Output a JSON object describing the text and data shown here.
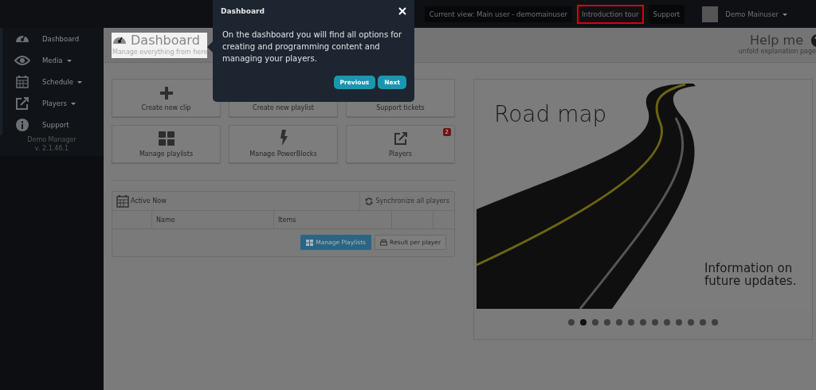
{
  "topbar": {
    "current_view": "Current view: Main user - demomainuser",
    "links": [
      {
        "label": "Introduction tour",
        "highlighted": true
      },
      {
        "label": "Support",
        "highlighted": false
      }
    ],
    "user": "Demo Mainuser"
  },
  "sidebar": {
    "items": [
      {
        "label": "Dashboard",
        "kind": "gauge",
        "has_menu": false
      },
      {
        "label": "Media",
        "kind": "eye",
        "has_menu": true
      },
      {
        "label": "Schedule",
        "kind": "calendar",
        "has_menu": true
      },
      {
        "label": "Players",
        "kind": "external",
        "has_menu": true
      },
      {
        "label": "Support",
        "kind": "info",
        "has_menu": false
      }
    ],
    "app_name": "Demo Manager",
    "version": "v. 2.1.46.1"
  },
  "header": {
    "title": "Dashboard",
    "subtitle": "Manage everything from here",
    "help_title": "Help me",
    "help_subtitle": "unfold explanation page"
  },
  "tiles": [
    {
      "label": "Create new clip",
      "kind": "plus"
    },
    {
      "label": "Create new playlist",
      "kind": "plain"
    },
    {
      "label": "Support tickets",
      "kind": "plain"
    },
    {
      "label": "Manage playlists",
      "kind": "grid"
    },
    {
      "label": "Manage PowerBlocks",
      "kind": "bolt"
    },
    {
      "label": "Players",
      "kind": "external",
      "badge": "2"
    }
  ],
  "active_now": {
    "title": "Active Now",
    "sync_button": "Synchronize all players",
    "columns": [
      "Name",
      "Items"
    ],
    "buttons": [
      {
        "label": "Manage Playlists",
        "primary": true
      },
      {
        "label": "Result per player",
        "primary": false
      }
    ]
  },
  "carousel": {
    "title": "Road map",
    "caption": "Information on future updates.",
    "dots": [
      {
        "selected": false
      },
      {
        "selected": true
      },
      {
        "selected": false
      },
      {
        "selected": false
      },
      {
        "selected": false
      },
      {
        "selected": false
      },
      {
        "selected": false
      },
      {
        "selected": false
      },
      {
        "selected": false
      },
      {
        "selected": false
      },
      {
        "selected": false
      },
      {
        "selected": false
      },
      {
        "selected": false
      }
    ]
  },
  "tour_popup": {
    "title": "Dashboard",
    "text": "On the dashboard you will find all options for creating and programming content and managing your players.",
    "buttons": [
      "Previous",
      "Next"
    ]
  }
}
